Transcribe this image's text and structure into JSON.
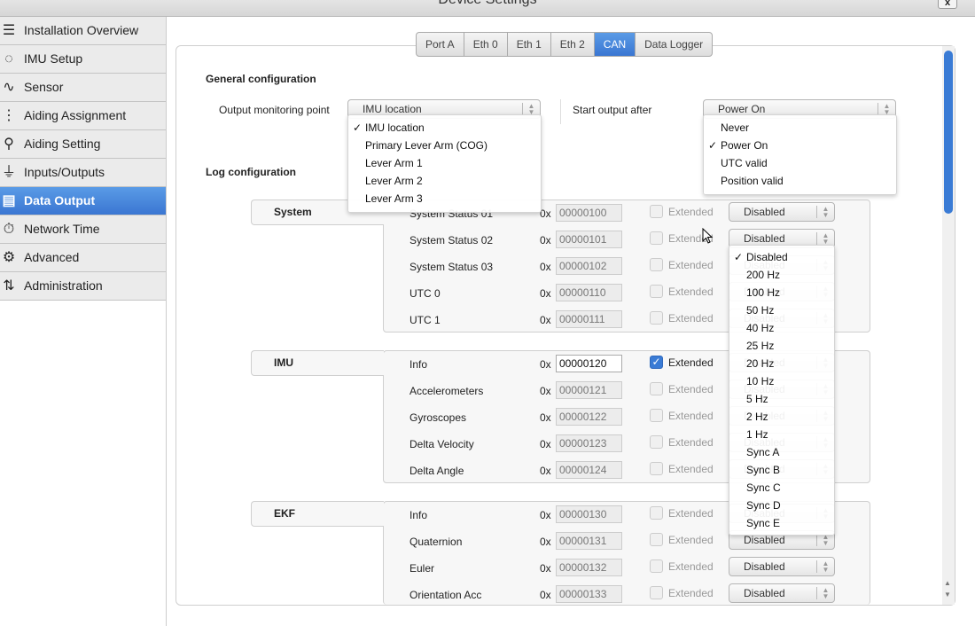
{
  "window": {
    "title": "Device Settings",
    "close": "x"
  },
  "sidebar": {
    "items": [
      {
        "label": "Installation Overview",
        "icon": "list-check-icon",
        "glyph": "☰"
      },
      {
        "label": "IMU Setup",
        "icon": "imu-icon",
        "glyph": "◌"
      },
      {
        "label": "Sensor",
        "icon": "waveform-icon",
        "glyph": "∿"
      },
      {
        "label": "Aiding Assignment",
        "icon": "tree-icon",
        "glyph": "⋮"
      },
      {
        "label": "Aiding Setting",
        "icon": "location-pin-icon",
        "glyph": "⚲"
      },
      {
        "label": "Inputs/Outputs",
        "icon": "plug-icon",
        "glyph": "⏚"
      },
      {
        "label": "Data Output",
        "icon": "document-edit-icon",
        "glyph": "▤",
        "active": true
      },
      {
        "label": "Network Time",
        "icon": "stopwatch-icon",
        "glyph": "⏱"
      },
      {
        "label": "Advanced",
        "icon": "gear-icon",
        "glyph": "⚙"
      },
      {
        "label": "Administration",
        "icon": "up-down-arrows-icon",
        "glyph": "⇅"
      }
    ]
  },
  "tabs": [
    {
      "label": "Port A"
    },
    {
      "label": "Eth 0"
    },
    {
      "label": "Eth 1"
    },
    {
      "label": "Eth 2"
    },
    {
      "label": "CAN",
      "active": true
    },
    {
      "label": "Data Logger"
    }
  ],
  "general": {
    "heading": "General configuration",
    "monitor_label": "Output monitoring point",
    "monitor_value": "IMU location",
    "monitor_options": [
      "IMU location",
      "Primary Lever Arm (COG)",
      "Lever Arm 1",
      "Lever Arm 2",
      "Lever Arm 3"
    ],
    "start_label": "Start output after",
    "start_value": "Power On",
    "start_options": [
      "Never",
      "Power On",
      "UTC valid",
      "Position valid"
    ]
  },
  "log": {
    "heading": "Log configuration",
    "prefix": "0x",
    "extended_label": "Extended",
    "groups": [
      {
        "name": "System",
        "rows": [
          {
            "label": "System Status 01",
            "id": "00000100",
            "extended": false,
            "rate": "Disabled"
          },
          {
            "label": "System Status 02",
            "id": "00000101",
            "extended": false,
            "rate": "Disabled"
          },
          {
            "label": "System Status 03",
            "id": "00000102",
            "extended": false,
            "rate": "Disabled"
          },
          {
            "label": "UTC 0",
            "id": "00000110",
            "extended": false,
            "rate": "Disabled"
          },
          {
            "label": "UTC 1",
            "id": "00000111",
            "extended": false,
            "rate": "Disabled"
          }
        ]
      },
      {
        "name": "IMU",
        "rows": [
          {
            "label": "Info",
            "id": "00000120",
            "extended": true,
            "rate": "Disabled"
          },
          {
            "label": "Accelerometers",
            "id": "00000121",
            "extended": false,
            "rate": "Disabled"
          },
          {
            "label": "Gyroscopes",
            "id": "00000122",
            "extended": false,
            "rate": "Disabled"
          },
          {
            "label": "Delta Velocity",
            "id": "00000123",
            "extended": false,
            "rate": "Disabled"
          },
          {
            "label": "Delta Angle",
            "id": "00000124",
            "extended": false,
            "rate": "Disabled"
          }
        ]
      },
      {
        "name": "EKF",
        "rows": [
          {
            "label": "Info",
            "id": "00000130",
            "extended": false,
            "rate": "Disabled"
          },
          {
            "label": "Quaternion",
            "id": "00000131",
            "extended": false,
            "rate": "Disabled"
          },
          {
            "label": "Euler",
            "id": "00000132",
            "extended": false,
            "rate": "Disabled"
          },
          {
            "label": "Orientation Acc",
            "id": "00000133",
            "extended": false,
            "rate": "Disabled"
          }
        ]
      }
    ]
  },
  "rate_menu": {
    "selected": "Disabled",
    "options": [
      "Disabled",
      "200 Hz",
      "100 Hz",
      "50 Hz",
      "40 Hz",
      "25 Hz",
      "20 Hz",
      "10 Hz",
      "5 Hz",
      "2 Hz",
      "1 Hz",
      "Sync A",
      "Sync B",
      "Sync C",
      "Sync D",
      "Sync E"
    ]
  },
  "colors": {
    "accent": "#3a7bd5"
  }
}
